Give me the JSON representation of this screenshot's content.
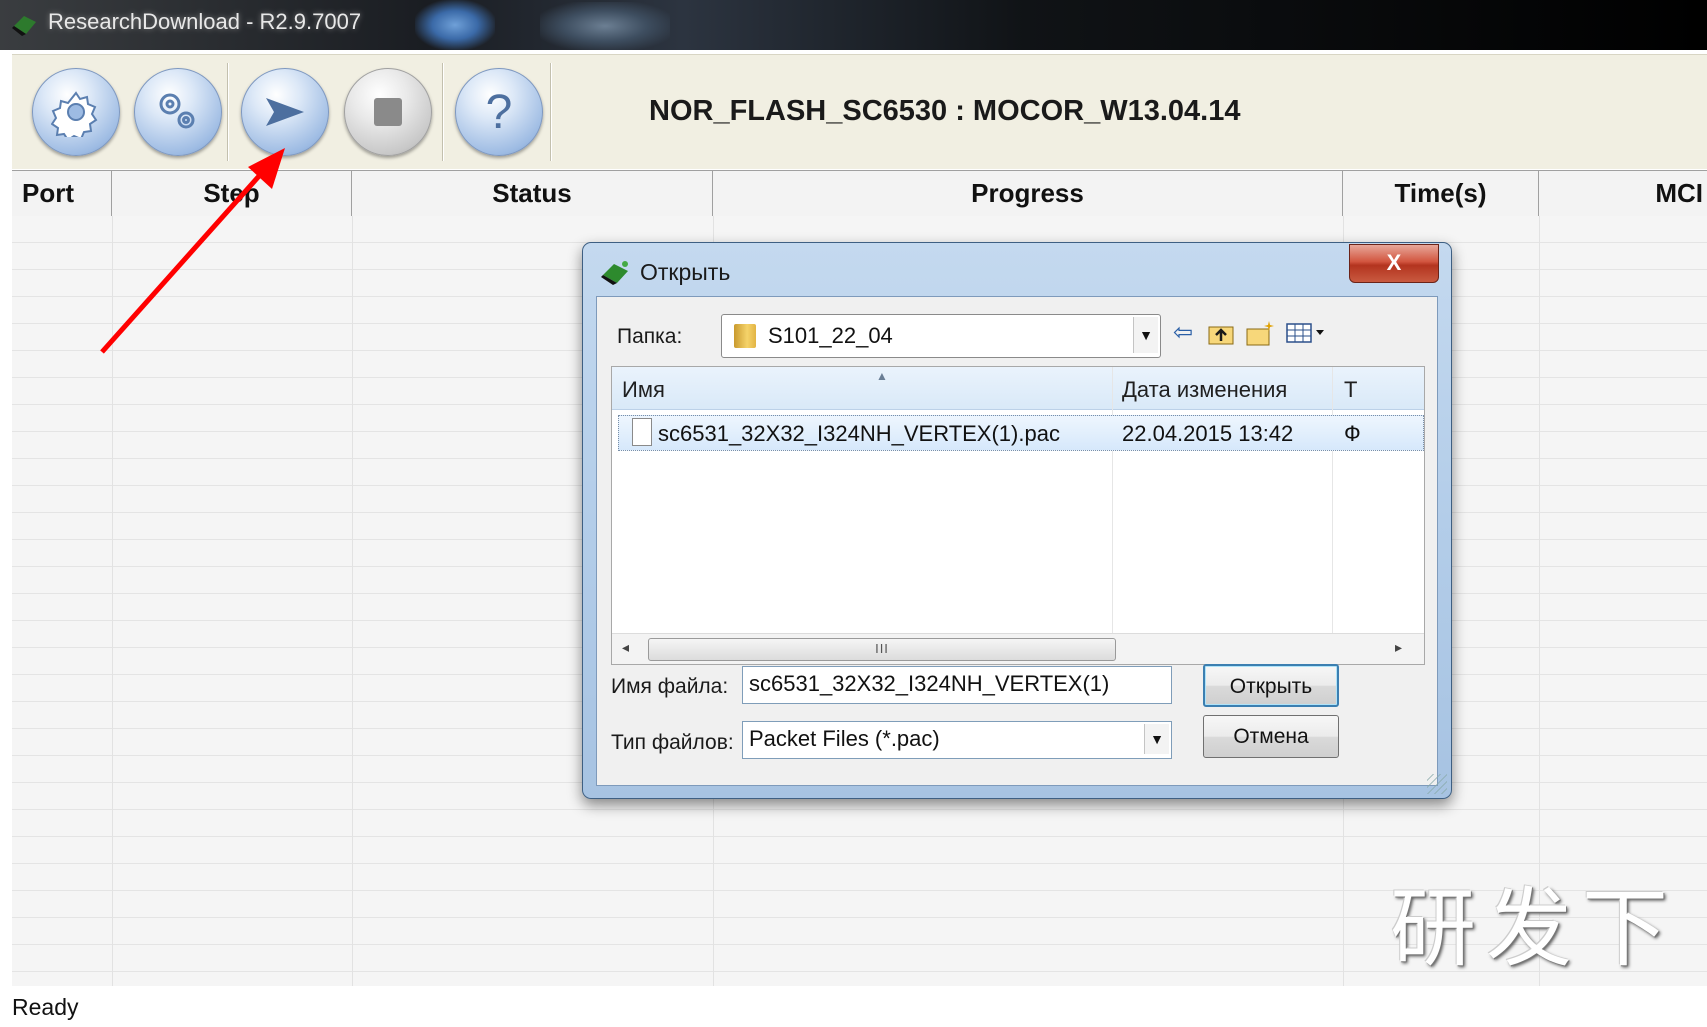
{
  "window": {
    "title": "ResearchDownload - R2.9.7007"
  },
  "toolbar": {
    "buttons": [
      {
        "name": "load-packet-button",
        "icon": "gear-icon"
      },
      {
        "name": "settings-button",
        "icon": "gears-icon"
      },
      {
        "name": "start-download-button",
        "icon": "play-arrow-icon"
      },
      {
        "name": "stop-download-button",
        "icon": "stop-square-icon"
      },
      {
        "name": "help-button",
        "icon": "question-mark-icon"
      }
    ],
    "project_title": "NOR_FLASH_SC6530 : MOCOR_W13.04.14"
  },
  "grid": {
    "columns": [
      "Port",
      "Step",
      "Status",
      "Progress",
      "Time(s)",
      "MCI"
    ]
  },
  "watermark": "研发下",
  "status_bar": {
    "text": "Ready"
  },
  "annotation": {
    "color": "#ff0000",
    "icon": "red-arrow"
  },
  "dialog": {
    "title": "Открыть",
    "close_label": "X",
    "folder_label": "Папка:",
    "folder_value": "S101_22_04",
    "nav_icons": [
      "back-arrow-icon",
      "up-folder-icon",
      "new-folder-icon",
      "view-menu-icon"
    ],
    "list_columns": [
      "Имя",
      "Дата изменения",
      "Т"
    ],
    "files": [
      {
        "name": "sc6531_32X32_I324NH_VERTEX(1).pac",
        "modified": "22.04.2015 13:42",
        "type": "Ф"
      }
    ],
    "scrollbar_grip": "III",
    "filename_label": "Имя файла:",
    "filename_value": "sc6531_32X32_I324NH_VERTEX(1)",
    "filetype_label": "Тип файлов:",
    "filetype_value": "Packet Files (*.pac)",
    "open_button": "Открыть",
    "cancel_button": "Отмена"
  }
}
